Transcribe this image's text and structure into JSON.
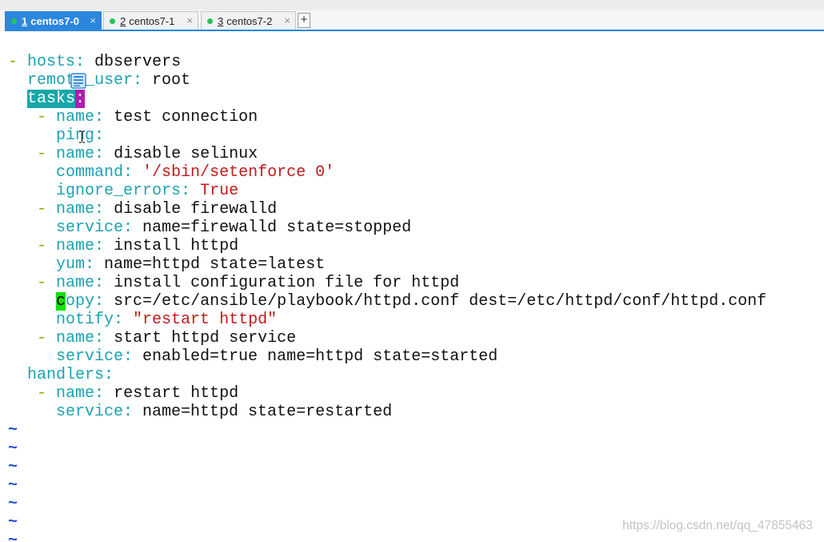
{
  "tabs": [
    {
      "number": "1",
      "name": "centos7-0",
      "close": "×",
      "active": true
    },
    {
      "number": "2",
      "name": "centos7-1",
      "close": "×",
      "active": false
    },
    {
      "number": "3",
      "name": "centos7-2",
      "close": "×",
      "active": false
    }
  ],
  "new_tab_label": "+",
  "icons": {
    "tab_status": "connection-status-icon",
    "overlay_note": "notes-icon",
    "mouse_pointer": "i-beam-cursor-icon"
  },
  "editor": {
    "lines": [
      {
        "segs": [
          {
            "t": "-",
            "k": "dash"
          },
          {
            "t": " "
          },
          {
            "t": "hosts:",
            "k": "key"
          },
          {
            "t": " dbservers"
          }
        ]
      },
      {
        "segs": [
          {
            "t": "  "
          },
          {
            "t": "remote_user:",
            "k": "key"
          },
          {
            "t": " root"
          }
        ]
      },
      {
        "segs": [
          {
            "t": "  "
          },
          {
            "t": "tasks",
            "k": "search"
          },
          {
            "t": ":",
            "k": "match"
          }
        ]
      },
      {
        "segs": [
          {
            "t": "   "
          },
          {
            "t": "-",
            "k": "dash"
          },
          {
            "t": " "
          },
          {
            "t": "name:",
            "k": "key"
          },
          {
            "t": " test connection"
          }
        ]
      },
      {
        "segs": [
          {
            "t": "     "
          },
          {
            "t": "ping:",
            "k": "key"
          }
        ]
      },
      {
        "segs": [
          {
            "t": "   "
          },
          {
            "t": "-",
            "k": "dash"
          },
          {
            "t": " "
          },
          {
            "t": "name:",
            "k": "key"
          },
          {
            "t": " disable selinux"
          }
        ]
      },
      {
        "segs": [
          {
            "t": "     "
          },
          {
            "t": "command:",
            "k": "key"
          },
          {
            "t": " "
          },
          {
            "t": "'/sbin/setenforce 0'",
            "k": "str"
          }
        ]
      },
      {
        "segs": [
          {
            "t": "     "
          },
          {
            "t": "ignore_errors:",
            "k": "key"
          },
          {
            "t": " "
          },
          {
            "t": "True",
            "k": "str"
          }
        ]
      },
      {
        "segs": [
          {
            "t": "   "
          },
          {
            "t": "-",
            "k": "dash"
          },
          {
            "t": " "
          },
          {
            "t": "name:",
            "k": "key"
          },
          {
            "t": " disable firewalld"
          }
        ]
      },
      {
        "segs": [
          {
            "t": "     "
          },
          {
            "t": "service:",
            "k": "key"
          },
          {
            "t": " name=firewalld state=stopped"
          }
        ]
      },
      {
        "segs": [
          {
            "t": "   "
          },
          {
            "t": "-",
            "k": "dash"
          },
          {
            "t": " "
          },
          {
            "t": "name:",
            "k": "key"
          },
          {
            "t": " install httpd"
          }
        ]
      },
      {
        "segs": [
          {
            "t": "     "
          },
          {
            "t": "yum:",
            "k": "key"
          },
          {
            "t": " name=httpd state=latest"
          }
        ]
      },
      {
        "segs": [
          {
            "t": "   "
          },
          {
            "t": "-",
            "k": "dash"
          },
          {
            "t": " "
          },
          {
            "t": "name:",
            "k": "key"
          },
          {
            "t": " install configuration file for httpd"
          }
        ]
      },
      {
        "segs": [
          {
            "t": "     "
          },
          {
            "t": "c",
            "k": "cursor"
          },
          {
            "t": "opy:",
            "k": "key"
          },
          {
            "t": " src=/etc/ansible/playbook/httpd.conf dest=/etc/httpd/conf/httpd.conf"
          }
        ]
      },
      {
        "segs": [
          {
            "t": "     "
          },
          {
            "t": "notify:",
            "k": "key"
          },
          {
            "t": " "
          },
          {
            "t": "\"restart httpd\"",
            "k": "str"
          }
        ]
      },
      {
        "segs": [
          {
            "t": "   "
          },
          {
            "t": "-",
            "k": "dash"
          },
          {
            "t": " "
          },
          {
            "t": "name:",
            "k": "key"
          },
          {
            "t": " start httpd service"
          }
        ]
      },
      {
        "segs": [
          {
            "t": "     "
          },
          {
            "t": "service:",
            "k": "key"
          },
          {
            "t": " enabled=true name=httpd state=started"
          }
        ]
      },
      {
        "segs": [
          {
            "t": "  "
          },
          {
            "t": "handlers:",
            "k": "key"
          }
        ]
      },
      {
        "segs": [
          {
            "t": "   "
          },
          {
            "t": "-",
            "k": "dash"
          },
          {
            "t": " "
          },
          {
            "t": "name:",
            "k": "key"
          },
          {
            "t": " restart httpd"
          }
        ]
      },
      {
        "segs": [
          {
            "t": "     "
          },
          {
            "t": "service:",
            "k": "key"
          },
          {
            "t": " name=httpd state=restarted"
          }
        ]
      },
      {
        "segs": [
          {
            "t": "~",
            "k": "nontext"
          }
        ]
      },
      {
        "segs": [
          {
            "t": "~",
            "k": "nontext"
          }
        ]
      },
      {
        "segs": [
          {
            "t": "~",
            "k": "nontext"
          }
        ]
      },
      {
        "segs": [
          {
            "t": "~",
            "k": "nontext"
          }
        ]
      },
      {
        "segs": [
          {
            "t": "~",
            "k": "nontext"
          }
        ]
      },
      {
        "segs": [
          {
            "t": "~",
            "k": "nontext"
          }
        ]
      },
      {
        "segs": [
          {
            "t": "~",
            "k": "nontext"
          }
        ]
      }
    ]
  },
  "watermark": "https://blog.csdn.net/qq_47855463",
  "colors": {
    "accent": "#2b86de",
    "key": "#1ba3b1",
    "dash": "#a39a00",
    "string": "#c21a1a",
    "plain": "#111111",
    "nontext": "#1f4fd6",
    "search_bg": "#17a7a9",
    "match_bg": "#b31bb3",
    "cursor_bg": "#12e012",
    "status_dot": "#21c45a",
    "watermark": "#c4c4c4"
  }
}
